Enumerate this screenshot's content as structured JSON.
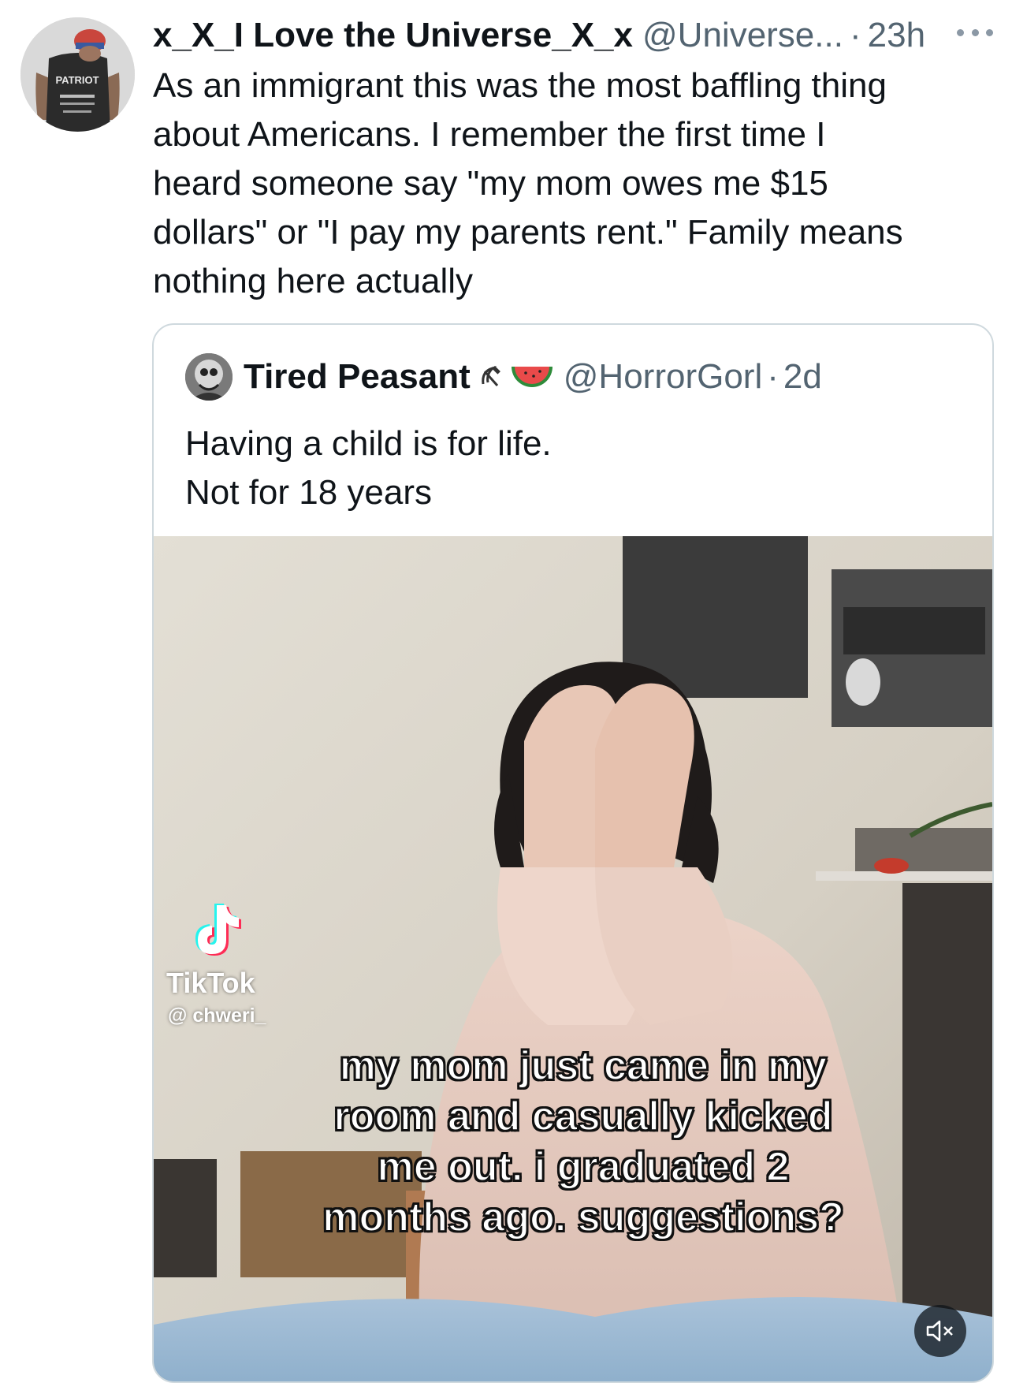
{
  "tweet": {
    "display_name": "x_X_I Love the Universe_X_x",
    "handle": "@Universe...",
    "separator": "·",
    "time": "23h",
    "text": "As an immigrant this was the most baffling thing\nabout Americans. I remember the first time I\nheard someone say \"my mom owes me $15\ndollars\" or \"I pay my parents rent.\" Family means\nnothing here actually"
  },
  "avatar_art": {
    "shirt_text": "PATRIOT"
  },
  "quote": {
    "display_name": "Tired Peasant",
    "name_emoji": [
      "hammer-sickle-icon",
      "watermelon-icon"
    ],
    "handle": "@HorrorGorl",
    "separator": "·",
    "time": "2d",
    "lines": [
      "Having a child is for life.",
      "Not for 18 years"
    ],
    "media": {
      "watermark_brand": "TikTok",
      "watermark_user": "@ chweri_",
      "caption": "my mom just came in my\nroom and casually kicked\nme out. i graduated 2\nmonths ago. suggestions?",
      "muted": true
    }
  },
  "colors": {
    "text_primary": "#0f1419",
    "text_secondary": "#536471",
    "border": "#cfd9de"
  }
}
